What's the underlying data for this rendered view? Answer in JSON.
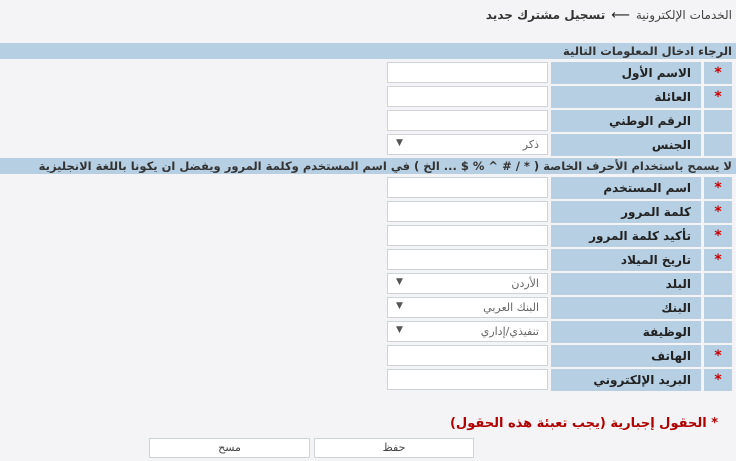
{
  "breadcrumb": {
    "parent": "الخدمات الإلكترونية",
    "arrow": "⟵",
    "current": "تسجيل مشترك جديد"
  },
  "sections": {
    "info": "الرجاء ادخال المعلومات التالية",
    "charset_note": "لا يسمح باستخدام الأحرف الخاصة ( * / # ^ % $ ... الخ ) في اسم المستخدم وكلمة المرور ويفضل ان يكونا باللغة الانجليزية"
  },
  "fields": {
    "first_name": {
      "label": "الاسم الأول",
      "required": "*",
      "value": ""
    },
    "family": {
      "label": "العائلة",
      "required": "*",
      "value": ""
    },
    "national_id": {
      "label": "الرقم الوطني",
      "value": ""
    },
    "gender": {
      "label": "الجنس",
      "value": "ذكر"
    },
    "username": {
      "label": "اسم المستخدم",
      "required": "*",
      "value": ""
    },
    "password": {
      "label": "كلمة المرور",
      "required": "*",
      "value": ""
    },
    "confirm_password": {
      "label": "تأكيد كلمة المرور",
      "required": "*",
      "value": ""
    },
    "birth_date": {
      "label": "تاريخ الميلاد",
      "required": "*",
      "value": ""
    },
    "country": {
      "label": "البلد",
      "value": "الأردن"
    },
    "bank": {
      "label": "البنك",
      "value": "البنك العربي"
    },
    "job": {
      "label": "الوظيفة",
      "value": "تنفيذي/إداري"
    },
    "phone": {
      "label": "الهاتف",
      "required": "*",
      "value": ""
    },
    "email": {
      "label": "البريد الإلكتروني",
      "required": "*",
      "value": ""
    }
  },
  "required_note": "* الحقول إجبارية (يجب تعبئة هذه الحقول)",
  "buttons": {
    "save": "حفظ",
    "clear": "مسح"
  },
  "icons": {
    "dropdown": "chevron-down-icon"
  },
  "colors": {
    "label_bg": "#b6cfe3",
    "required": "#c00000",
    "page_bg": "#f4f4f6"
  }
}
